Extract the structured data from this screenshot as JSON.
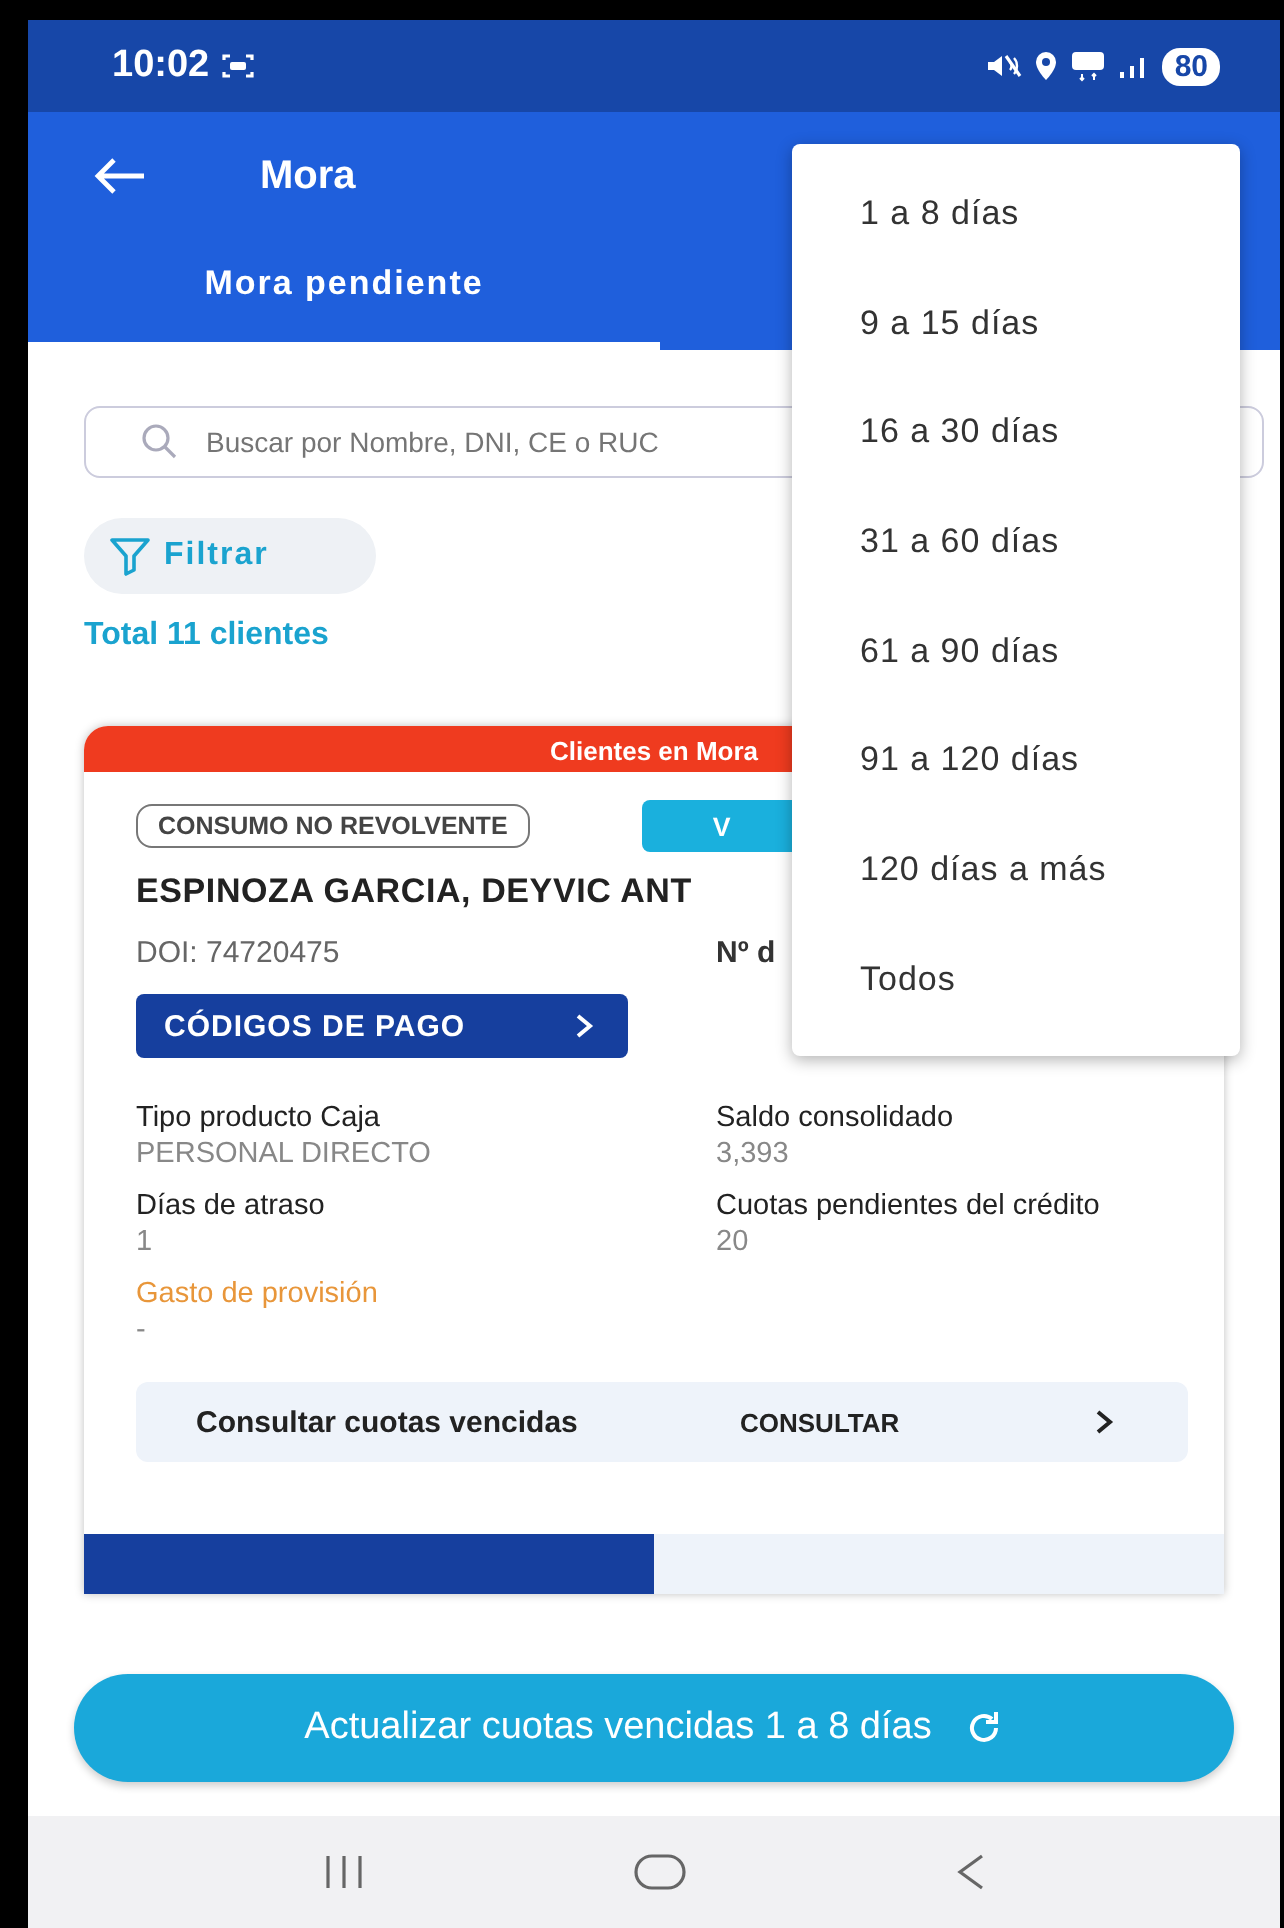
{
  "status_bar": {
    "time": "10:02",
    "battery": "80"
  },
  "app_bar": {
    "title": "Mora"
  },
  "tabs": [
    {
      "label": "Mora pendiente",
      "selected": true
    }
  ],
  "search": {
    "placeholder": "Buscar por Nombre, DNI, CE o RUC"
  },
  "filter_button": "Filtrar",
  "total": "Total 11 clientes",
  "card": {
    "header": "Clientes en Mora",
    "tag": "CONSUMO NO REVOLVENTE",
    "side_button": "V",
    "name": "ESPINOZA GARCIA, DEYVIC ANT",
    "doi": "DOI: 74720475",
    "doi_right": "Nº d",
    "codes_button": "CÓDIGOS DE PAGO",
    "fields": [
      {
        "label": "Tipo producto Caja",
        "value": "PERSONAL DIRECTO",
        "kind": "normal"
      },
      {
        "label": "Saldo consolidado",
        "value": "3,393",
        "kind": "normal"
      },
      {
        "label": "Días de atraso",
        "value": "1",
        "kind": "normal"
      },
      {
        "label": "Cuotas pendientes del crédito",
        "value": "20",
        "kind": "normal"
      },
      {
        "label": "Gasto de provisión",
        "value": "-",
        "kind": "warning"
      }
    ],
    "consult_row": {
      "label": "Consultar cuotas vencidas",
      "action": "CONSULTAR"
    },
    "bottom_tabs": [
      {
        "selected": true
      },
      {
        "selected": false
      }
    ]
  },
  "update_button": "Actualizar cuotas vencidas 1 a 8 días",
  "menu": {
    "items": [
      "1 a 8 días",
      "9 a 15 días",
      "16 a 30 días",
      "31 a 60 días",
      "61 a 90 días",
      "91 a 120 días",
      "120 días a más",
      "Todos"
    ]
  }
}
